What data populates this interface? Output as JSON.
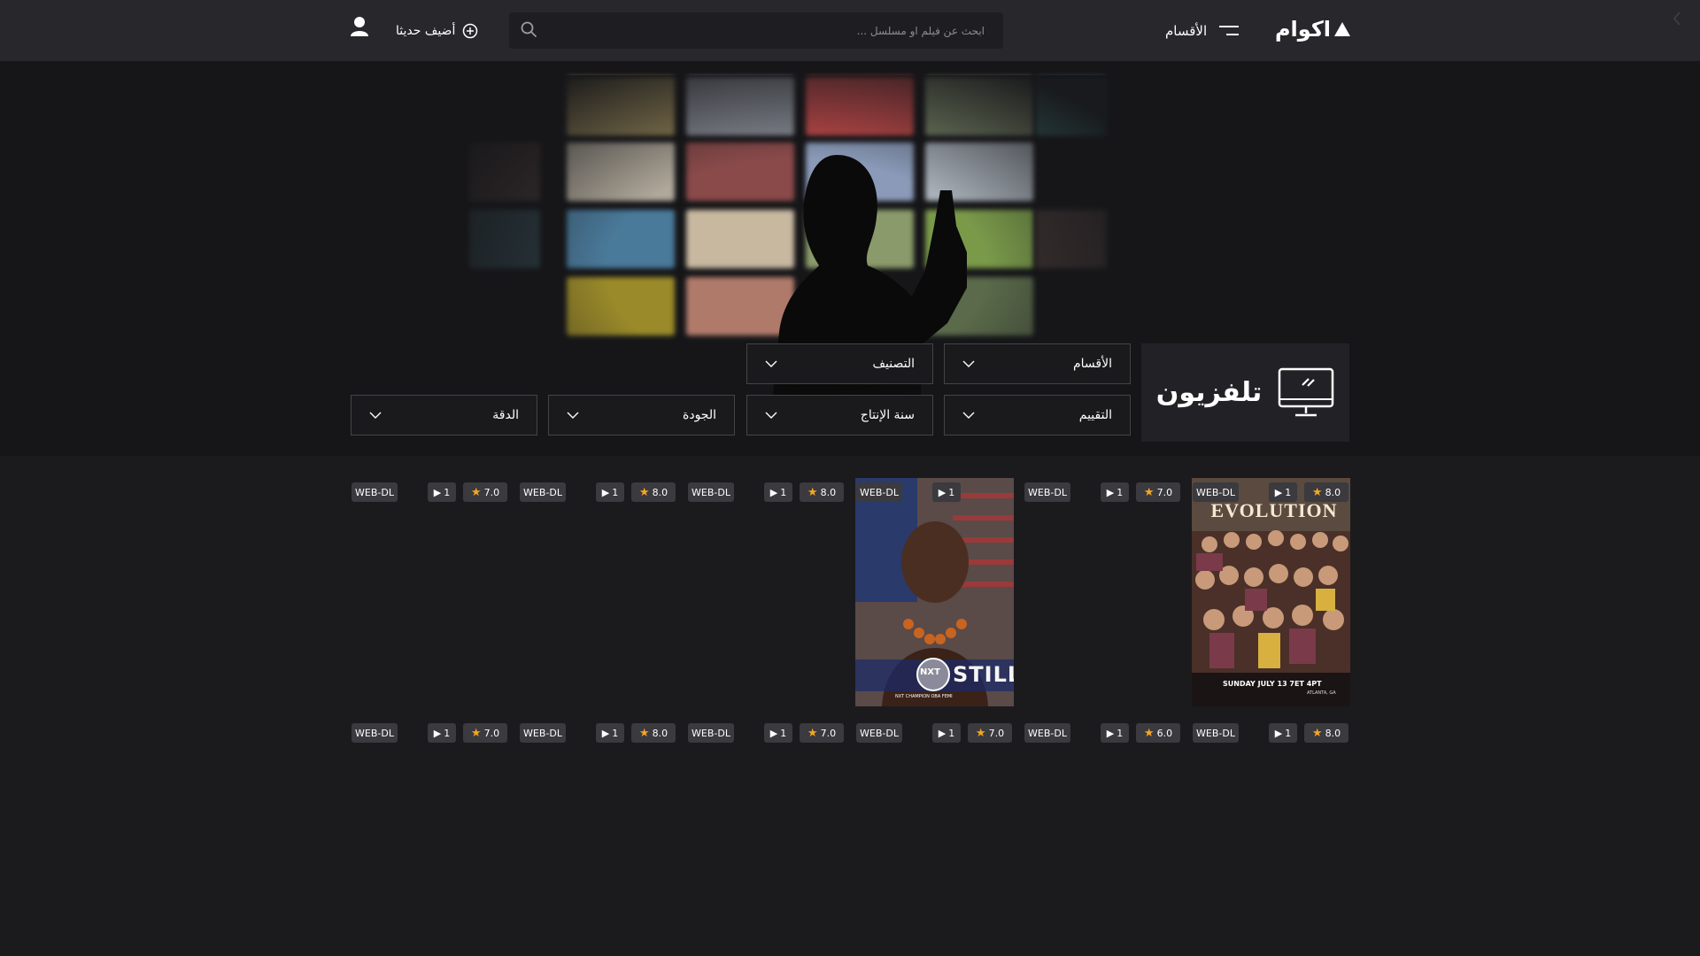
{
  "header": {
    "logo_text": "اكوام",
    "menu_label": "الأقسام",
    "search_placeholder": "ابحث عن فيلم او مسلسل ...",
    "add_new_label": "أضيف حديثا"
  },
  "filters": {
    "sections": "الأقسام",
    "classification": "التصنيف",
    "rating": "التقييم",
    "year": "سنة الإنتاج",
    "quality": "الجودة",
    "resolution": "الدقة"
  },
  "category": {
    "title": "تلفزيون",
    "icon": "tv-icon"
  },
  "row1": [
    {
      "rating": "8.0",
      "episodes": "1",
      "quality": "WEB-DL",
      "has_poster": true,
      "poster_theme": "evolution"
    },
    {
      "rating": "7.0",
      "episodes": "1",
      "quality": "WEB-DL",
      "has_poster": false
    },
    {
      "rating": "",
      "episodes": "1",
      "quality": "WEB-DL",
      "has_poster": true,
      "poster_theme": "nxt"
    },
    {
      "rating": "8.0",
      "episodes": "1",
      "quality": "WEB-DL",
      "has_poster": false
    },
    {
      "rating": "8.0",
      "episodes": "1",
      "quality": "WEB-DL",
      "has_poster": false
    },
    {
      "rating": "7.0",
      "episodes": "1",
      "quality": "WEB-DL",
      "has_poster": false
    }
  ],
  "row2": [
    {
      "rating": "8.0",
      "episodes": "1",
      "quality": "WEB-DL"
    },
    {
      "rating": "6.0",
      "episodes": "1",
      "quality": "WEB-DL"
    },
    {
      "rating": "7.0",
      "episodes": "1",
      "quality": "WEB-DL"
    },
    {
      "rating": "7.0",
      "episodes": "1",
      "quality": "WEB-DL"
    },
    {
      "rating": "8.0",
      "episodes": "1",
      "quality": "WEB-DL"
    },
    {
      "rating": "7.0",
      "episodes": "1",
      "quality": "WEB-DL"
    }
  ],
  "poster_texts": {
    "evolution_title": "EVOLUTION",
    "evolution_date": "SUNDAY JULY 13 7ET 4PT",
    "evolution_place": "ATLANTA, GA",
    "nxt_logo": "NXT",
    "nxt_caption": "NXT CHAMPION OBA FEMI",
    "nxt_big": "STILL"
  },
  "colors": {
    "header_bg": "#27272c",
    "page_bg": "#1b1b1e",
    "badge_bg": "#3a3a3f",
    "star": "#f5a623"
  }
}
